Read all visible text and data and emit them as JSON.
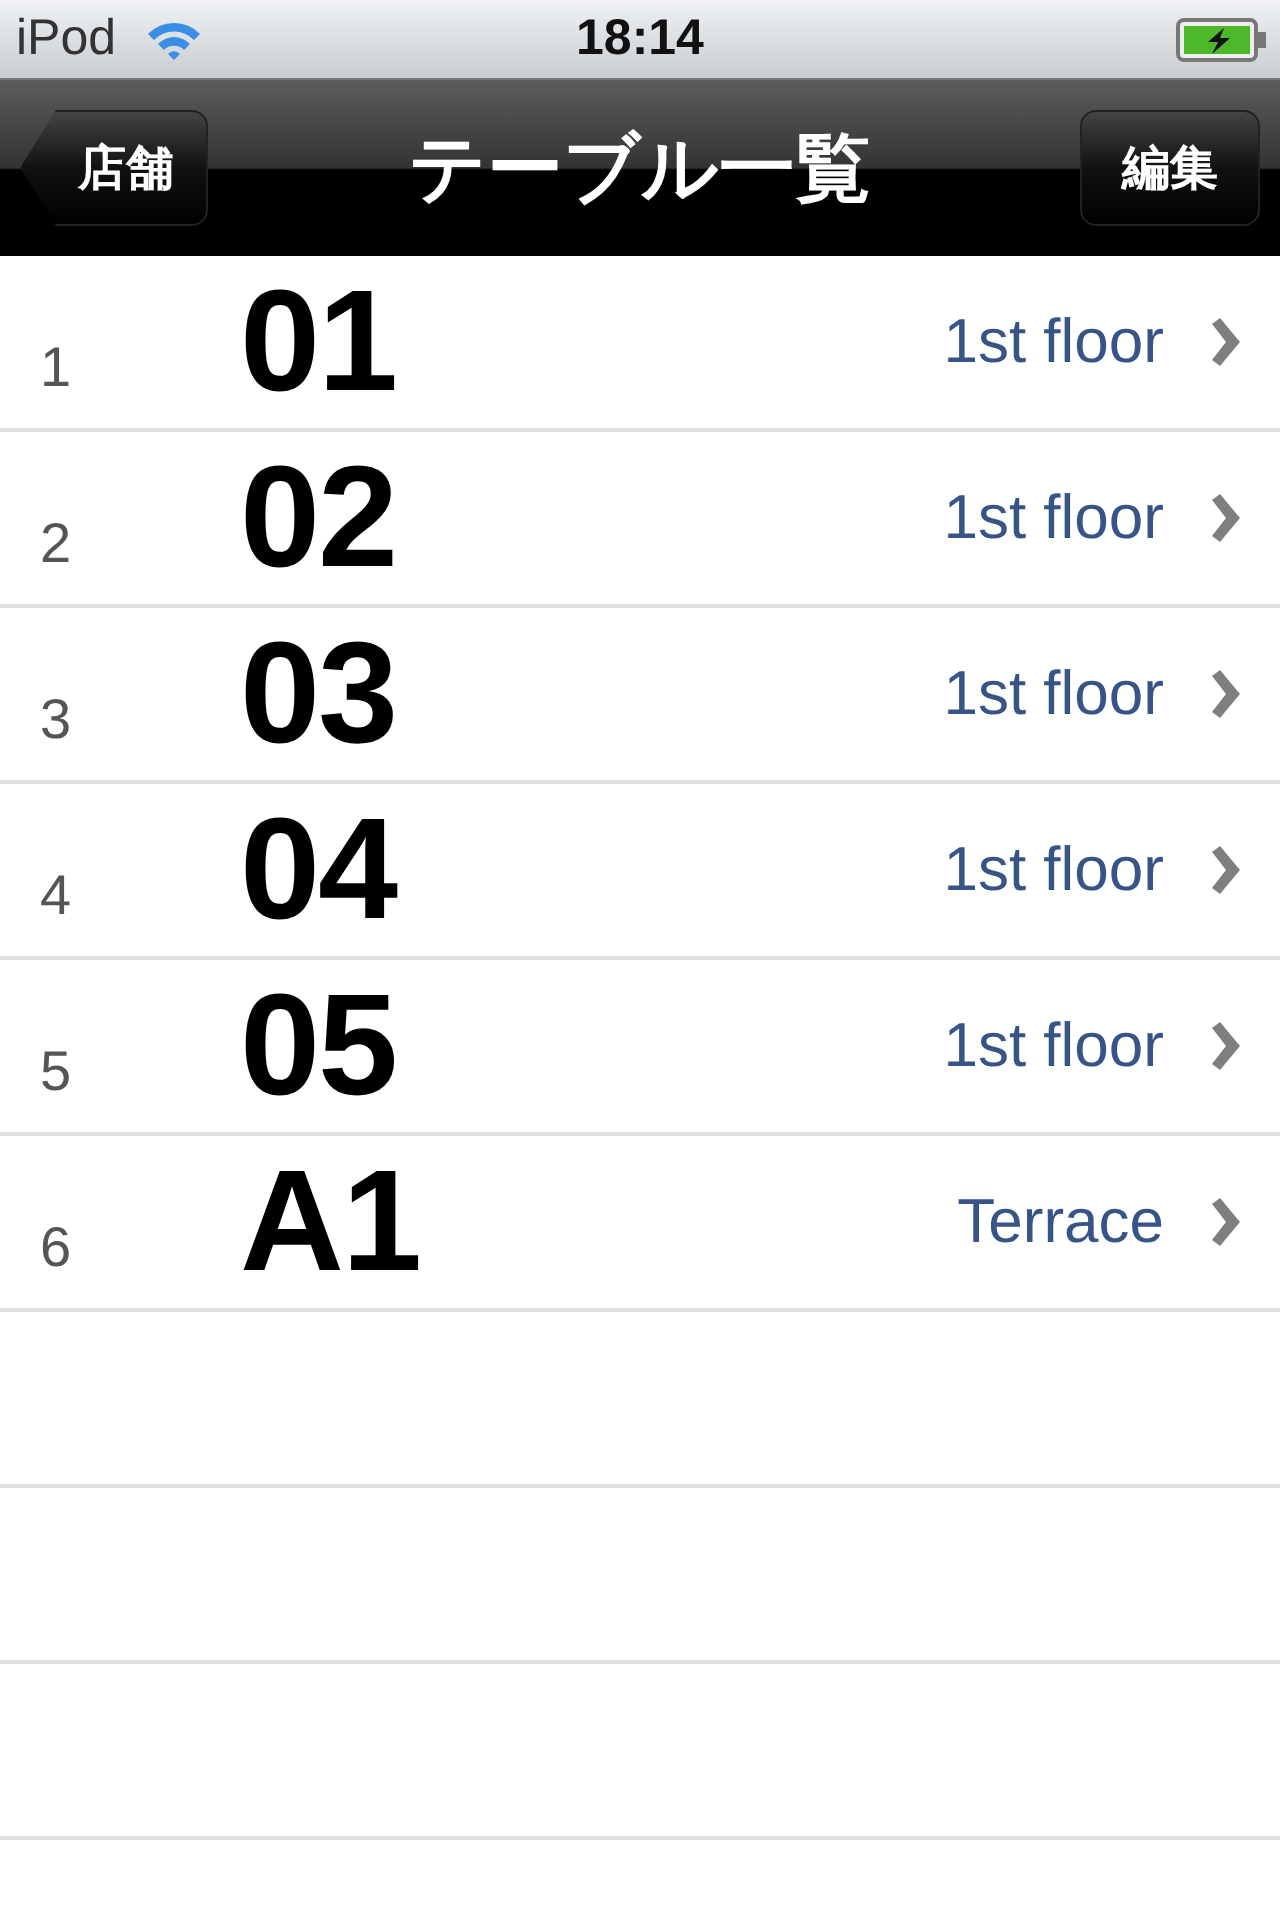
{
  "status_bar": {
    "carrier": "iPod",
    "time": "18:14"
  },
  "nav_bar": {
    "back_button": "店舗",
    "title": "テーブル一覧",
    "edit_button": "編集"
  },
  "rows": [
    {
      "number": "1",
      "name": "01",
      "detail": "1st floor"
    },
    {
      "number": "2",
      "name": "02",
      "detail": "1st floor"
    },
    {
      "number": "3",
      "name": "03",
      "detail": "1st floor"
    },
    {
      "number": "4",
      "name": "04",
      "detail": "1st floor"
    },
    {
      "number": "5",
      "name": "05",
      "detail": "1st floor"
    },
    {
      "number": "6",
      "name": "A1",
      "detail": "Terrace"
    }
  ]
}
